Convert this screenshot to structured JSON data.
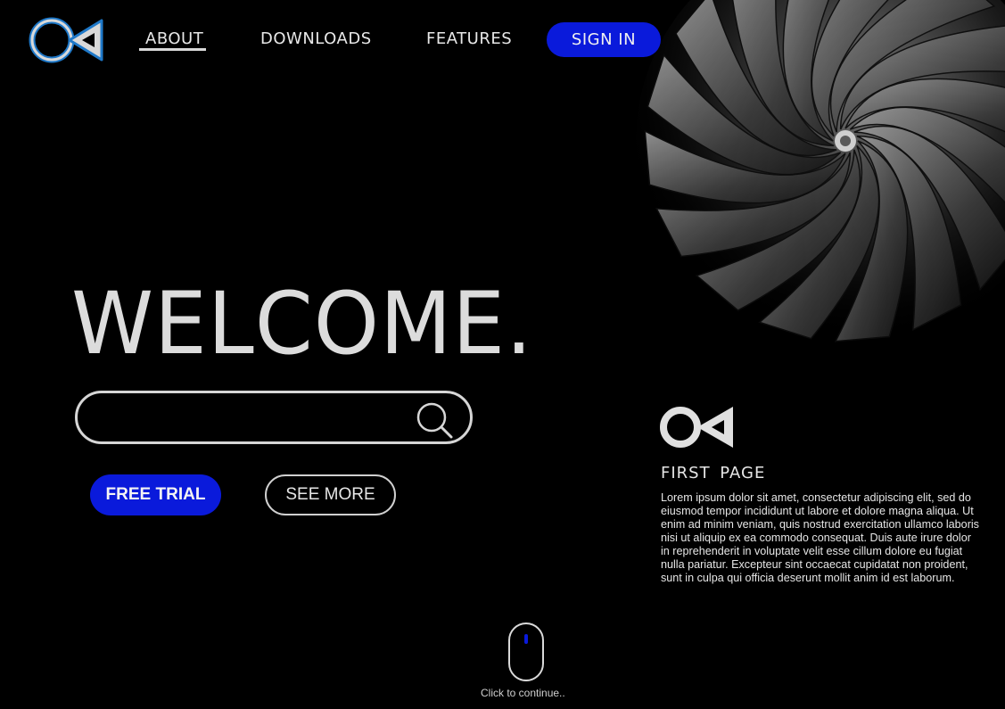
{
  "nav": {
    "items": [
      {
        "label": "ABOUT",
        "active": true
      },
      {
        "label": "DOWNLOADS",
        "active": false
      },
      {
        "label": "FEATURES",
        "active": false
      }
    ],
    "sign_in_label": "SIGN IN"
  },
  "hero": {
    "headline": "WELCOME.",
    "search": {
      "value": "",
      "placeholder": ""
    },
    "primary_button": "FREE TRIAL",
    "secondary_button": "SEE MORE"
  },
  "panel": {
    "title": "FIRST  PAGE",
    "body": "Lorem ipsum dolor sit amet, consectetur adipiscing elit, sed do eiusmod tempor incididunt ut labore et dolore magna aliqua. Ut enim ad minim veniam, quis nostrud exercitation ullamco laboris nisi ut aliquip ex ea commodo consequat. Duis aute irure dolor in reprehenderit in voluptate velit esse cillum dolore eu fugiat nulla pariatur. Excepteur sint occaecat cupidatat non proident, sunt in culpa qui officia deserunt mollit anim id est laborum."
  },
  "footer": {
    "continue_text": "Click to continue.."
  },
  "icons": {
    "logo": "brand-logo-icon",
    "search": "search-icon",
    "scroll": "mouse-scroll-icon"
  },
  "colors": {
    "background": "#000000",
    "accent": "#0a1adb",
    "logo_outline": "#1e78c8",
    "text": "#e6e6e6"
  }
}
